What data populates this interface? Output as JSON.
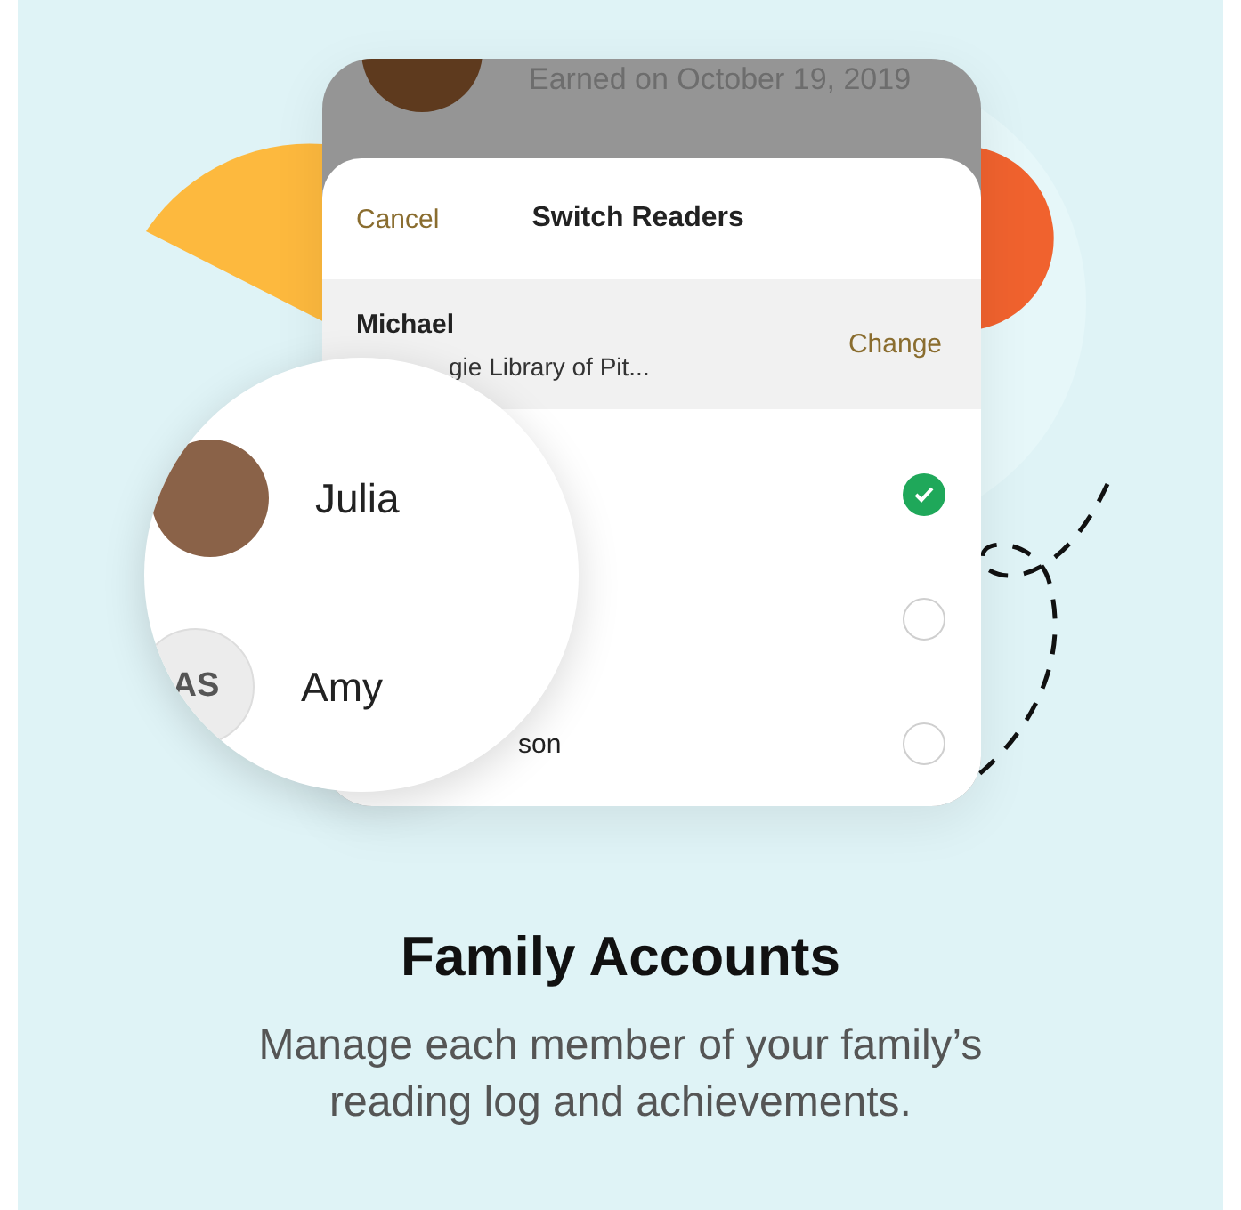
{
  "background_screen": {
    "caption": "Earned on October 19, 2019"
  },
  "sheet": {
    "cancel": "Cancel",
    "title": "Switch Readers",
    "current_reader": {
      "name": "Michael",
      "library": "gie Library of Pit...",
      "action": "Change"
    },
    "readers": [
      {
        "selected": true
      },
      {
        "selected": false
      },
      {
        "name": "son",
        "selected": false
      }
    ]
  },
  "magnifier": {
    "readers": [
      {
        "kind": "photo",
        "name": "Julia"
      },
      {
        "kind": "initials",
        "initials": "AS",
        "name": "Amy"
      }
    ]
  },
  "heading": "Family Accounts",
  "description": "Manage each member of your family’s reading log and achievements."
}
